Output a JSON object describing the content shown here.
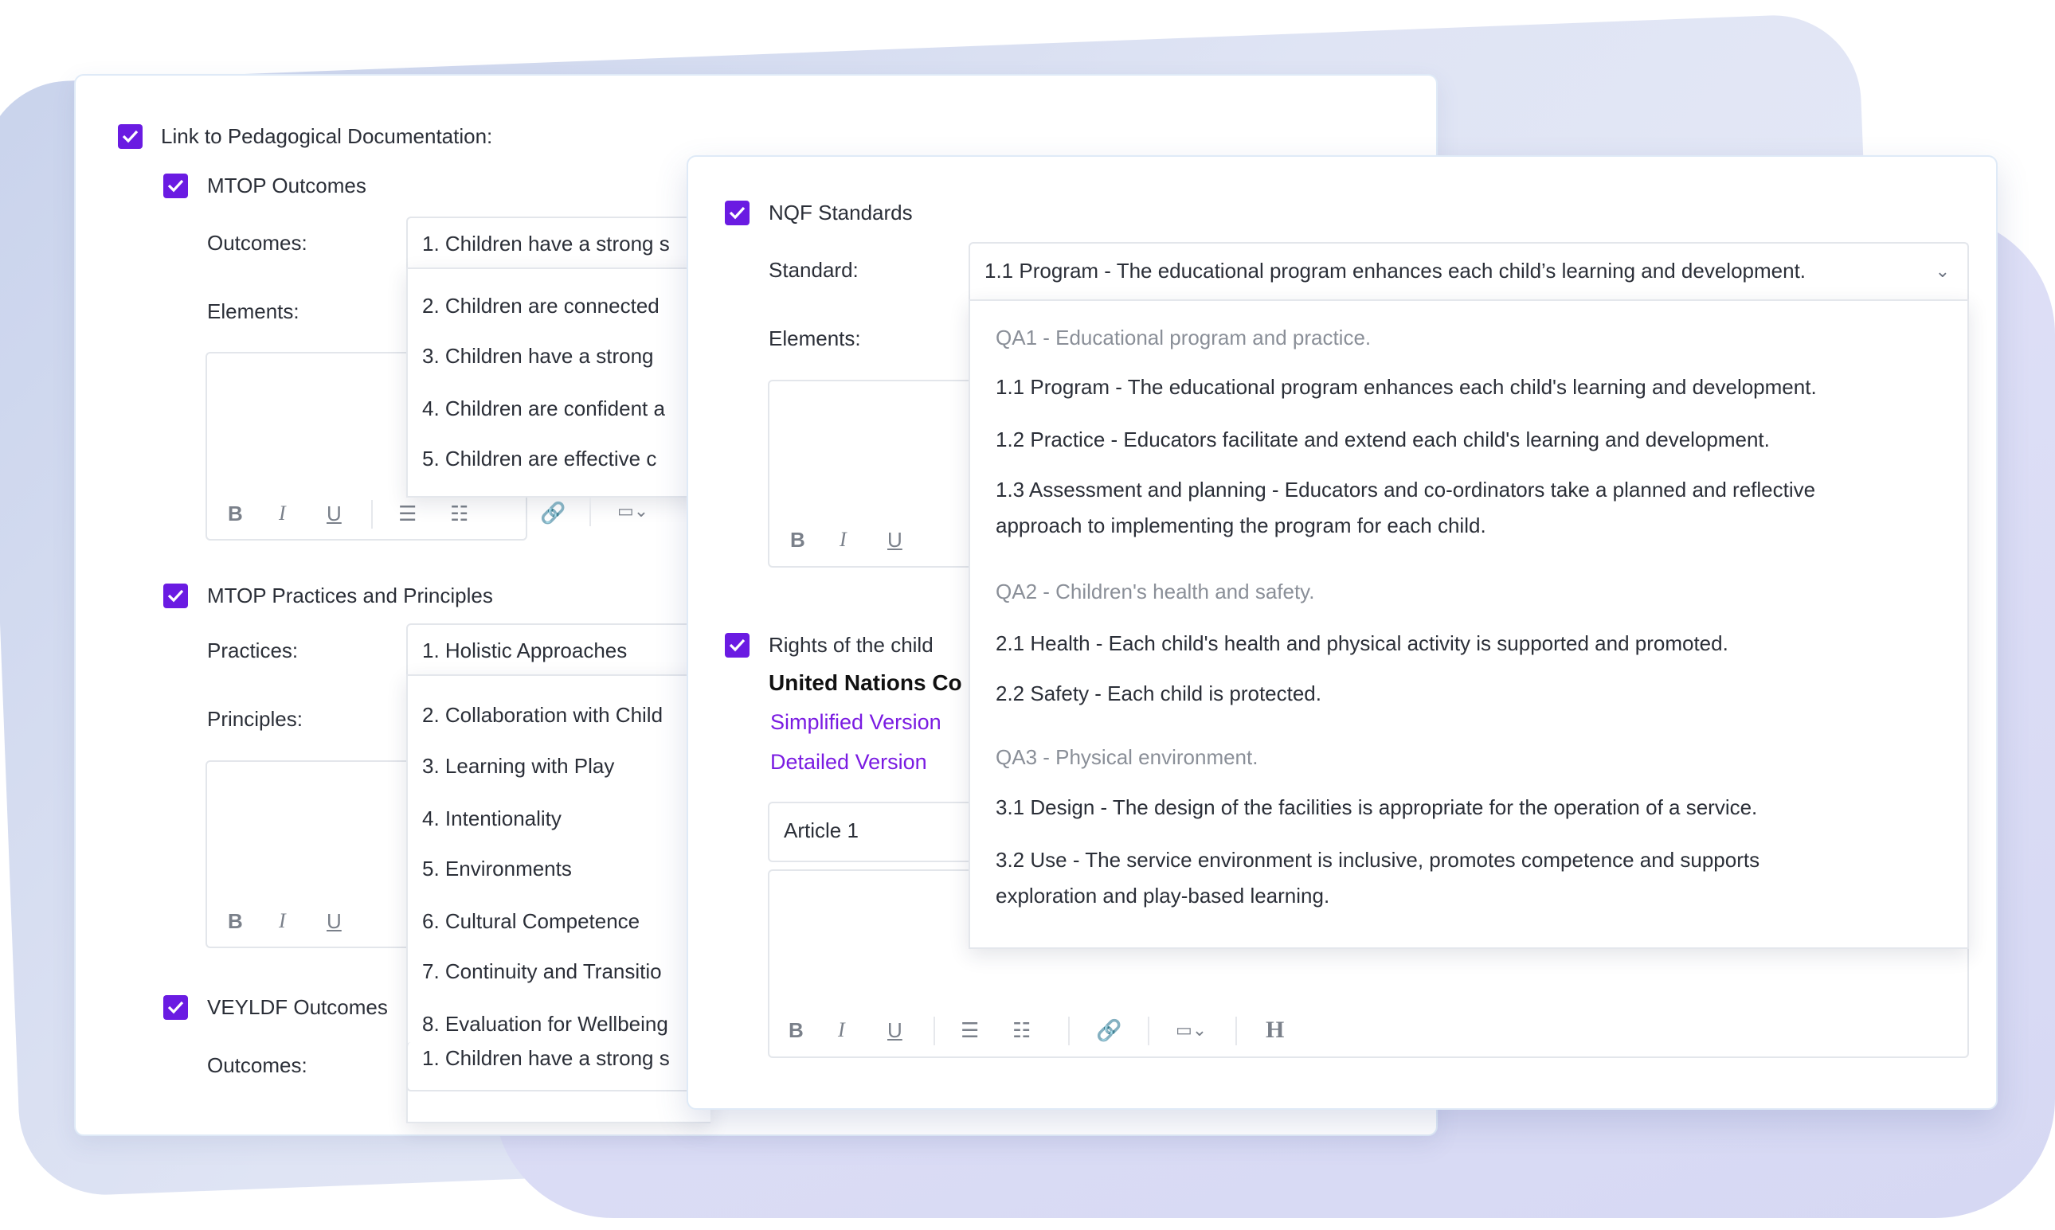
{
  "left": {
    "link_label": "Link to Pedagogical Documentation:",
    "mtop_outcomes": {
      "label": "MTOP Outcomes",
      "outcomes_label": "Outcomes:",
      "elements_label": "Elements:",
      "selected": "1.  Children have a strong s",
      "options": [
        "2.  Children are connected",
        "3.  Children have a strong",
        "4.  Children are confident a",
        "5.  Children are effective c"
      ]
    },
    "mtop_practices": {
      "label": "MTOP Practices and Principles",
      "practices_label": "Practices:",
      "principles_label": "Principles:",
      "selected": "1.  Holistic Approaches",
      "options": [
        "2.  Collaboration with Child",
        "3.  Learning with Play",
        "4.  Intentionality",
        "5.  Environments",
        "6.  Cultural Competence",
        "7.  Continuity and Transitio",
        "8.  Evaluation for Wellbeing"
      ]
    },
    "veyldf": {
      "label": "VEYLDF Outcomes",
      "outcomes_label": "Outcomes:",
      "selected": "1.  Children have a strong s"
    }
  },
  "right": {
    "nqf_label": "NQF Standards",
    "standard_label": "Standard:",
    "elements_label": "Elements:",
    "selected": "1.1  Program - The educational program enhances each child’s learning and development.",
    "groups": [
      {
        "title": "QA1 - Educational program and practice.",
        "items": [
          "1.1   Program - The educational program enhances each child's learning and development.",
          "1.2  Practice - Educators facilitate and extend each child's learning and development.",
          "1.3  Assessment and planning - Educators and co-ordinators take a planned and reflective",
          "approach to implementing the program for each child."
        ]
      },
      {
        "title": "QA2 - Children's health and safety.",
        "items": [
          "2.1   Health - Each child's health and physical activity is supported and promoted.",
          "2.2  Safety - Each child is protected."
        ]
      },
      {
        "title": "QA3 - Physical environment.",
        "items": [
          "3.1   Design - The design of the facilities is appropriate for the operation of a service.",
          "3.2  Use - The service environment is inclusive, promotes competence and supports",
          "exploration and play-based learning."
        ]
      }
    ],
    "rights_label": "Rights of the child",
    "un_title": "United Nations Co",
    "simplified_link": "Simplified Version",
    "detailed_link": "Detailed Version",
    "article": "Article 1"
  },
  "colors": {
    "accent": "#6a1be2",
    "link": "#7a1be2"
  }
}
